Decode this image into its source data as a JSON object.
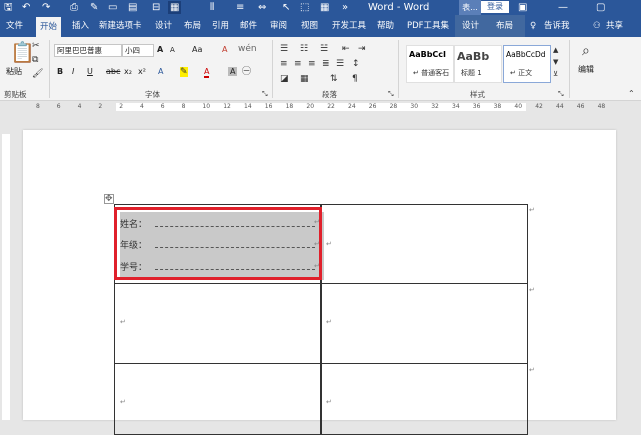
{
  "window": {
    "title": "Word - Word",
    "context_tab_label": "表...",
    "login_label": "登录",
    "colors": {
      "accent": "#2b579a",
      "highlight_box": "#e0202b"
    }
  },
  "quick_access": {
    "icons": [
      "save-icon",
      "undo-icon",
      "redo-icon",
      "print-preview-icon",
      "format-painter-icon",
      "new-doc-icon",
      "open-icon"
    ]
  },
  "tabs": [
    {
      "label": "文件"
    },
    {
      "label": "开始"
    },
    {
      "label": "插入"
    },
    {
      "label": "新建选项卡"
    },
    {
      "label": "设计"
    },
    {
      "label": "布局"
    },
    {
      "label": "引用"
    },
    {
      "label": "邮件"
    },
    {
      "label": "审阅"
    },
    {
      "label": "视图"
    },
    {
      "label": "开发工具"
    },
    {
      "label": "帮助"
    },
    {
      "label": "PDF工具集"
    },
    {
      "label": "设计"
    },
    {
      "label": "布局"
    },
    {
      "label": "告诉我"
    },
    {
      "label": "共享"
    }
  ],
  "ribbon": {
    "clipboard": {
      "paste": "粘贴",
      "group": "剪贴板"
    },
    "font": {
      "name": "阿里巴巴普惠",
      "size": "小四",
      "group": "字体",
      "buttons": {
        "bold": "B",
        "italic": "I",
        "underline": "U",
        "strike": "abc",
        "sub": "x₂",
        "sup": "x²",
        "grow": "A",
        "shrink": "A",
        "case": "Aa",
        "clear": "A",
        "color_a": "A",
        "border_a": "A"
      }
    },
    "paragraph": {
      "group": "段落"
    },
    "styles": {
      "group": "样式",
      "items": [
        {
          "sample": "AaBbCcI",
          "name": "↵ 普通客石"
        },
        {
          "sample": "AaBb",
          "name": "标题 1"
        },
        {
          "sample": "AaBbCcDd",
          "name": "↵ 正文"
        }
      ]
    },
    "editing": {
      "label": "编辑"
    }
  },
  "ruler": {
    "marks": [
      "8",
      "6",
      "4",
      "2",
      "2",
      "4",
      "6",
      "8",
      "10",
      "12",
      "14",
      "16",
      "18",
      "20",
      "22",
      "24",
      "26",
      "28",
      "30",
      "32",
      "34",
      "36",
      "38",
      "40",
      "42",
      "44",
      "46",
      "48"
    ]
  },
  "document": {
    "fields": [
      {
        "label": "姓名："
      },
      {
        "label": "年级："
      },
      {
        "label": "学号："
      }
    ],
    "para_mark": "↵"
  }
}
